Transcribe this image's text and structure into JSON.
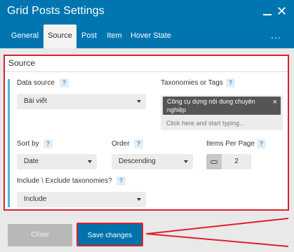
{
  "window": {
    "title": "Grid Posts Settings",
    "close_glyph": "✕"
  },
  "tabs": [
    {
      "label": "General",
      "active": false
    },
    {
      "label": "Source",
      "active": true
    },
    {
      "label": "Post",
      "active": false
    },
    {
      "label": "Item",
      "active": false
    },
    {
      "label": "Hover State",
      "active": false
    }
  ],
  "tabs_more": "...",
  "source": {
    "heading": "Source",
    "help_glyph": "?",
    "data_source": {
      "label": "Data source",
      "value": "Bài viết"
    },
    "taxonomies": {
      "label": "Taxonomies or Tags",
      "tags": [
        {
          "text": "Công cụ dựng nội dung chuyên nghiệp",
          "remove_glyph": "×"
        }
      ],
      "placeholder": "Click here and start typing..."
    },
    "sort_by": {
      "label": "Sort by",
      "value": "Date"
    },
    "order": {
      "label": "Order",
      "value": "Descending"
    },
    "items_per_page": {
      "label": "Items Per Page",
      "value": "2",
      "icon": "link-icon"
    },
    "include_exclude": {
      "label": "Include \\ Exclude taxonomies?",
      "value": "Include"
    }
  },
  "footer": {
    "close_label": "Close",
    "save_label": "Save changes"
  },
  "colors": {
    "header_bg": "#0075b0",
    "highlight_red": "#e0202a",
    "accent_blue": "#4fb6e0",
    "save_button": "#0073aa"
  }
}
